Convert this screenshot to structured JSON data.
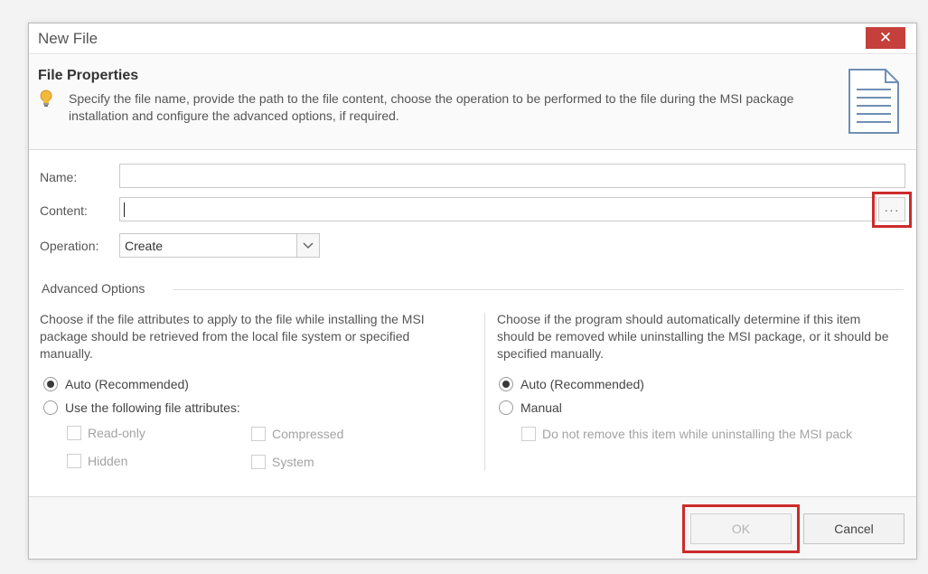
{
  "window": {
    "title": "New File",
    "close_glyph": "✕"
  },
  "header": {
    "title": "File Properties",
    "description": "Specify the file name, provide the path to the file content, choose the operation to be performed to the file during the MSI package installation and configure the advanced options, if required."
  },
  "form": {
    "name_label": "Name:",
    "name_value": "",
    "content_label": "Content:",
    "content_value": "",
    "browse_label": "···",
    "operation_label": "Operation:",
    "operation_value": "Create"
  },
  "advanced": {
    "title": "Advanced Options",
    "left": {
      "description": "Choose if the file attributes to apply to the file while installing the MSI package should be retrieved from the local file system or specified manually.",
      "option_auto": "Auto (Recommended)",
      "option_manual": "Use the following file attributes:",
      "selected": "auto",
      "attributes": {
        "read_only": "Read-only",
        "compressed": "Compressed",
        "hidden": "Hidden",
        "system": "System"
      }
    },
    "right": {
      "description": "Choose if the program should automatically determine if this item should be removed while uninstalling the MSI package, or it should be specified manually.",
      "option_auto": "Auto (Recommended)",
      "option_manual": "Manual",
      "selected": "auto",
      "do_not_remove": "Do not remove this item while uninstalling the MSI pack"
    }
  },
  "footer": {
    "ok_label": "OK",
    "cancel_label": "Cancel"
  },
  "colors": {
    "highlight": "#cc2b2b",
    "close_button": "#c5403b"
  },
  "icons": {
    "hint": "lightbulb-icon",
    "document": "document-icon",
    "dropdown": "chevron-down-icon"
  }
}
